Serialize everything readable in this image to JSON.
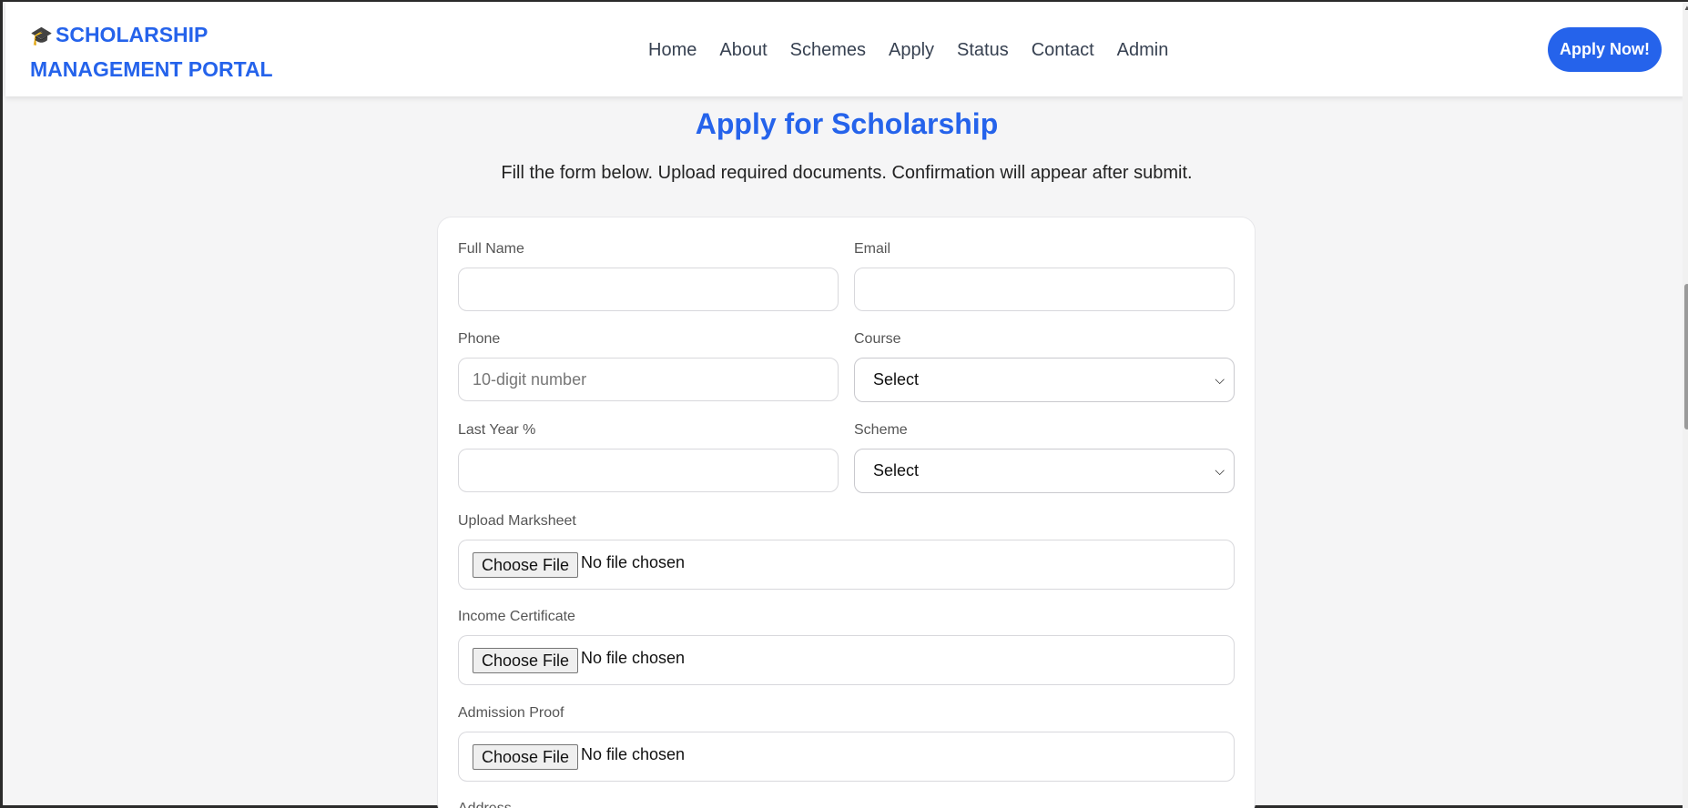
{
  "brand": {
    "line1": "SCHOLARSHIP",
    "line2": "MANAGEMENT PORTAL",
    "icon": "graduation-cap-icon"
  },
  "nav": {
    "items": [
      "Home",
      "About",
      "Schemes",
      "Apply",
      "Status",
      "Contact",
      "Admin"
    ],
    "cta_label": "Apply Now!"
  },
  "page": {
    "title": "Apply for Scholarship",
    "subtitle": "Fill the form below. Upload required documents. Confirmation will appear after submit."
  },
  "form": {
    "full_name": {
      "label": "Full Name",
      "value": "",
      "placeholder": ""
    },
    "email": {
      "label": "Email",
      "value": "",
      "placeholder": ""
    },
    "phone": {
      "label": "Phone",
      "value": "",
      "placeholder": "10-digit number"
    },
    "course": {
      "label": "Course",
      "selected": "Select"
    },
    "last_year_pct": {
      "label": "Last Year %",
      "value": "",
      "placeholder": ""
    },
    "scheme": {
      "label": "Scheme",
      "selected": "Select"
    },
    "uploads": [
      {
        "label": "Upload Marksheet",
        "button": "Choose File",
        "status": "No file chosen"
      },
      {
        "label": "Income Certificate",
        "button": "Choose File",
        "status": "No file chosen"
      },
      {
        "label": "Admission Proof",
        "button": "Choose File",
        "status": "No file chosen"
      }
    ],
    "address_label": "Address"
  },
  "colors": {
    "accent": "#2563eb",
    "background": "#f5f5f6",
    "card": "#ffffff"
  }
}
